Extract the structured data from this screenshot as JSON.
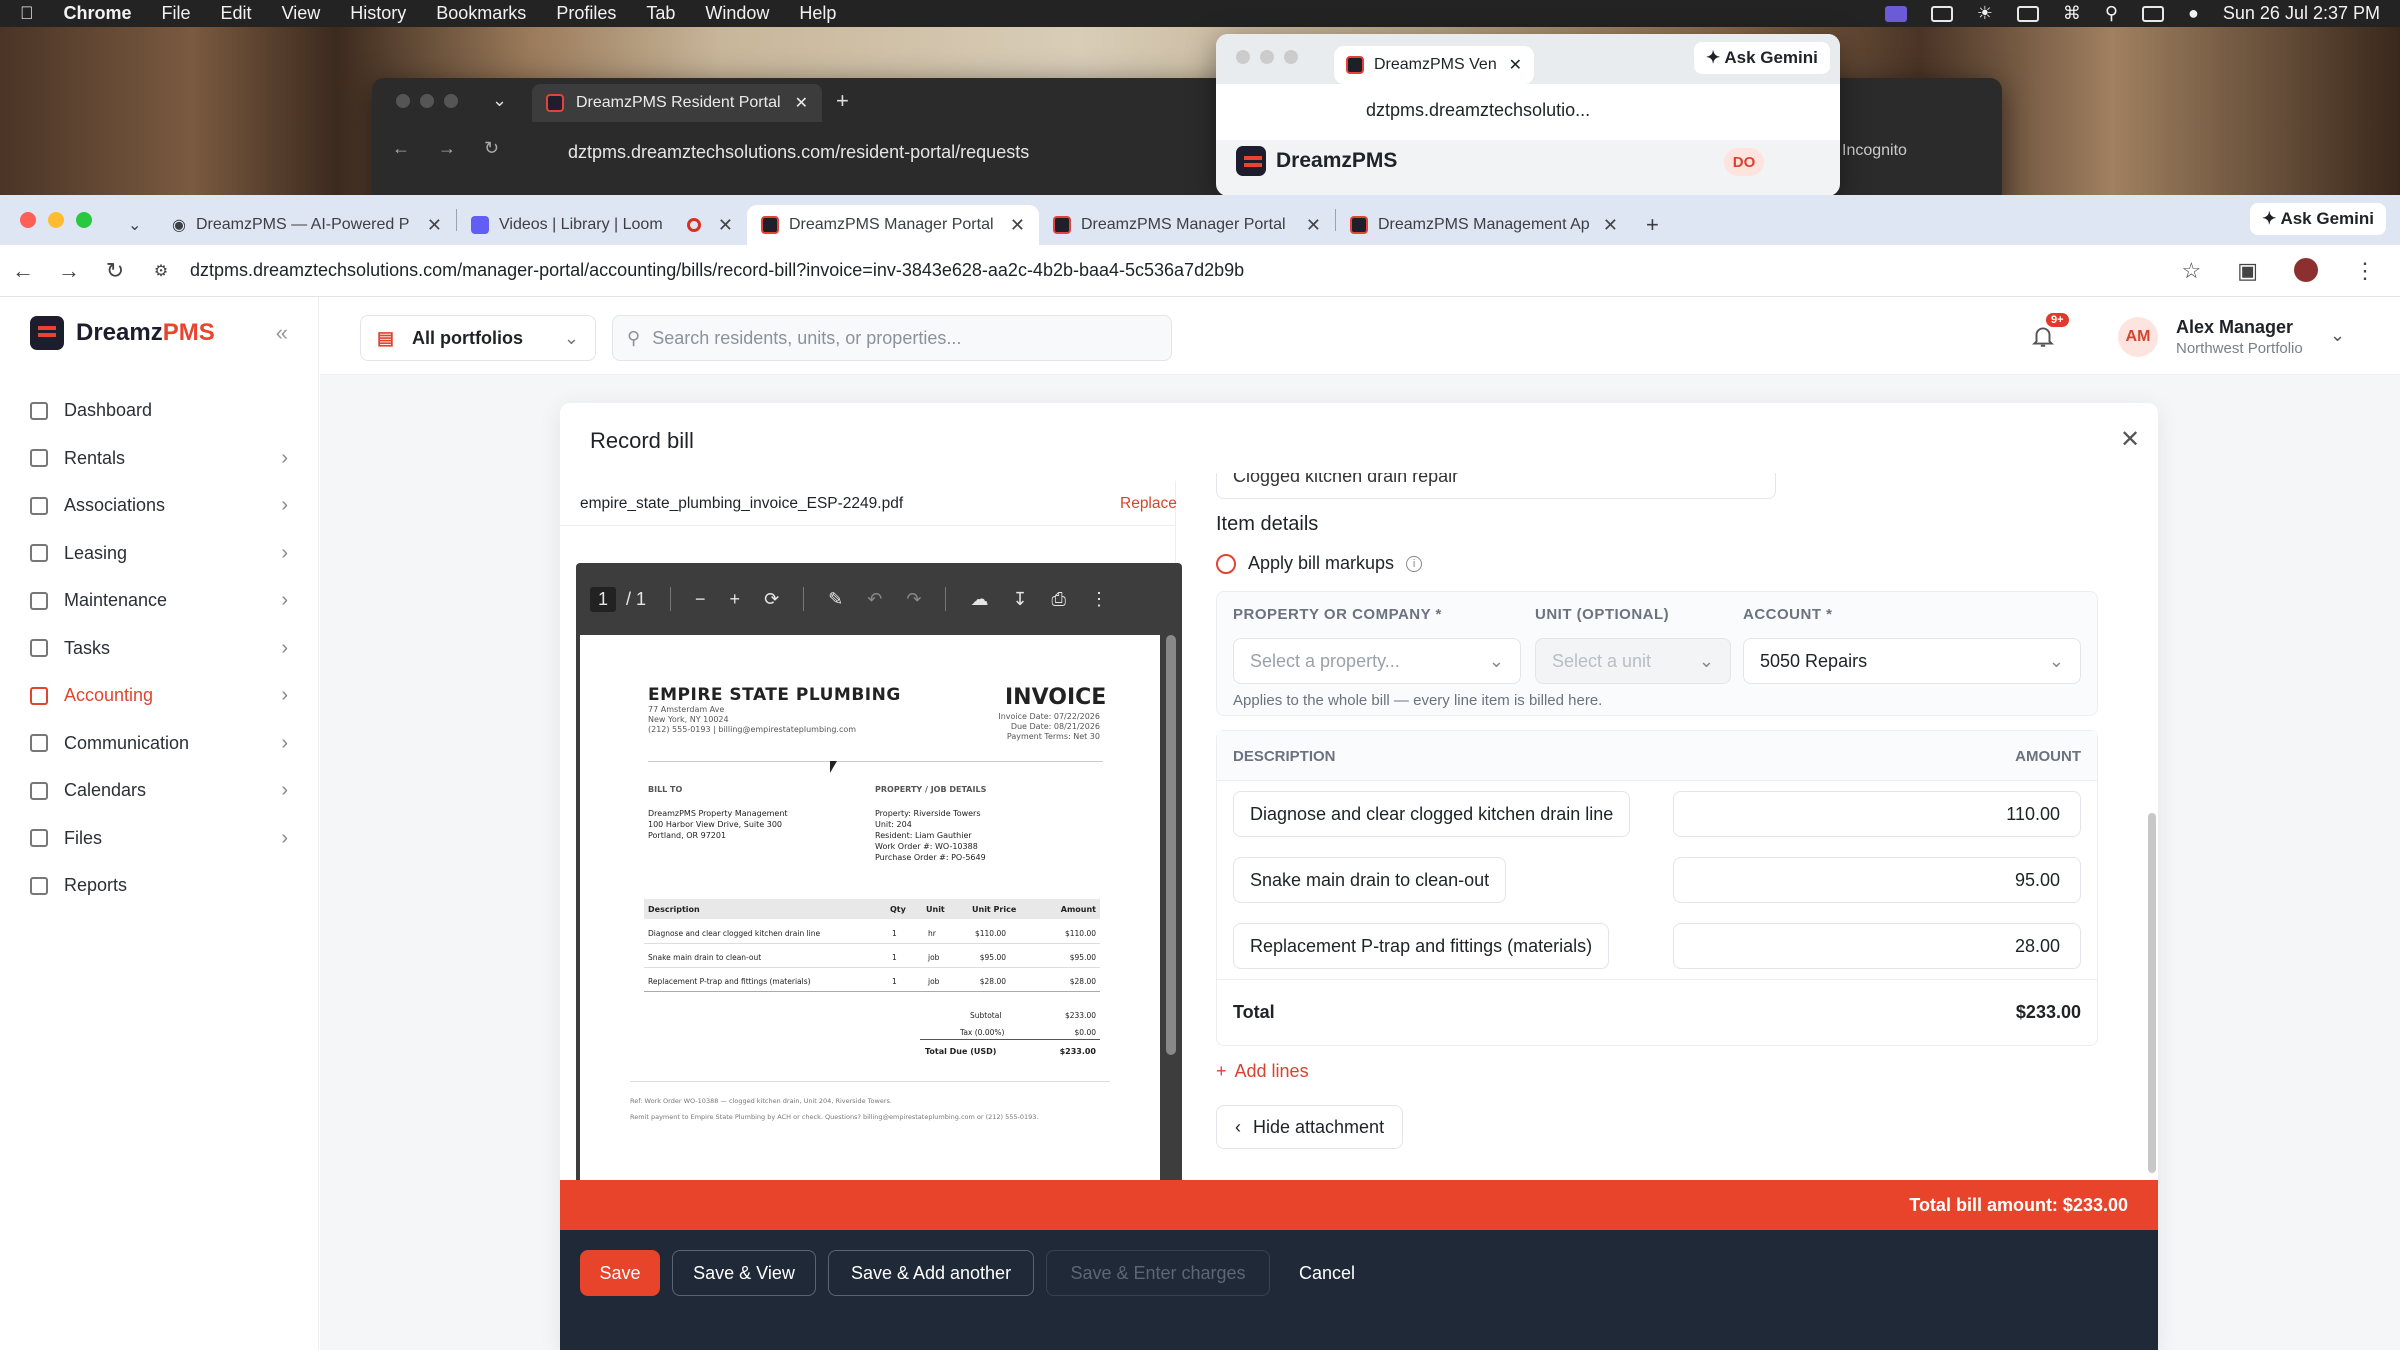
{
  "menubar": {
    "app": "Chrome",
    "items": [
      "File",
      "Edit",
      "View",
      "History",
      "Bookmarks",
      "Profiles",
      "Tab",
      "Window",
      "Help"
    ],
    "clock": "Sun 26 Jul  2:37 PM"
  },
  "bg_window_1": {
    "tab_title": "DreamzPMS Resident Portal",
    "url": "dztpms.dreamztechsolutions.com/resident-portal/requests"
  },
  "bg_window_2": {
    "tab_title": "DreamzPMS Ven",
    "ask_gemini": "Ask Gemini",
    "url": "dztpms.dreamztechsolutio...",
    "brand": "DreamzPMS",
    "avatar": "DO",
    "incognito": "Incognito"
  },
  "browser": {
    "tabs": [
      {
        "title": "DreamzPMS — AI-Powered P"
      },
      {
        "title": "Videos | Library | Loom"
      },
      {
        "title": "DreamzPMS Manager Portal"
      },
      {
        "title": "DreamzPMS Manager Portal"
      },
      {
        "title": "DreamzPMS Management Ap"
      }
    ],
    "ask_gemini": "Ask Gemini",
    "url": "dztpms.dreamztechsolutions.com/manager-portal/accounting/bills/record-bill?invoice=inv-3843e628-aa2c-4b2b-baa4-5c536a7d2b9b"
  },
  "sidebar": {
    "brand_prefix": "Dreamz",
    "brand_suffix": "PMS",
    "items": [
      {
        "label": "Dashboard"
      },
      {
        "label": "Rentals"
      },
      {
        "label": "Associations"
      },
      {
        "label": "Leasing"
      },
      {
        "label": "Maintenance"
      },
      {
        "label": "Tasks"
      },
      {
        "label": "Accounting"
      },
      {
        "label": "Communication"
      },
      {
        "label": "Calendars"
      },
      {
        "label": "Files"
      },
      {
        "label": "Reports"
      }
    ]
  },
  "topbar": {
    "portfolio": "All portfolios",
    "search_placeholder": "Search residents, units, or properties...",
    "badge": "9+",
    "avatar": "AM",
    "user_name": "Alex Manager",
    "user_sub": "Northwest Portfolio"
  },
  "modal": {
    "title": "Record bill",
    "file_name": "empire_state_plumbing_invoice_ESP-2249.pdf",
    "replace": "Replace",
    "pdf_page": "1",
    "pdf_total": "/  1",
    "memo_value": "Clogged kitchen drain repair",
    "item_details_title": "Item details",
    "apply_markups": "Apply bill markups",
    "property_label": "PROPERTY OR COMPANY *",
    "property_placeholder": "Select a property...",
    "unit_label": "UNIT (OPTIONAL)",
    "unit_placeholder": "Select a unit",
    "account_label": "ACCOUNT *",
    "account_value": "5050 Repairs",
    "hint": "Applies to the whole bill — every line item is billed here.",
    "col_description": "DESCRIPTION",
    "col_amount": "AMOUNT",
    "lines": [
      {
        "description": "Diagnose and clear clogged kitchen drain line",
        "amount": "110.00"
      },
      {
        "description": "Snake main drain to clean-out",
        "amount": "95.00"
      },
      {
        "description": "Replacement P-trap and fittings (materials)",
        "amount": "28.00"
      }
    ],
    "total_label": "Total",
    "total_value": "$233.00",
    "add_lines": "Add lines",
    "hide_attachment": "Hide attachment",
    "total_bill": "Total bill amount: $233.00",
    "buttons": {
      "save": "Save",
      "save_view": "Save & View",
      "save_add": "Save & Add another",
      "save_enter": "Save & Enter charges",
      "cancel": "Cancel"
    }
  },
  "invoice": {
    "company": "EMPIRE STATE PLUMBING",
    "address1": "77 Amsterdam Ave",
    "address2": "New York, NY 10024",
    "contact": "(212) 555-0193  |  billing@empirestateplumbing.com",
    "heading": "INVOICE",
    "invoice_date": "Invoice Date: 07/22/2026",
    "due_date": "Due Date: 08/21/2026",
    "terms": "Payment Terms: Net 30",
    "bill_to_label": "BILL TO",
    "bill_to_1": "DreamzPMS Property Management",
    "bill_to_2": "100 Harbor View Drive, Suite 300",
    "bill_to_3": "Portland, OR 97201",
    "job_label": "PROPERTY / JOB DETAILS",
    "job_1": "Property: Riverside Towers",
    "job_2": "Unit: 204",
    "job_3": "Resident: Liam Gauthier",
    "job_4": "Work Order #: WO-10388",
    "job_5": "Purchase Order #: PO-5649",
    "th_desc": "Description",
    "th_qty": "Qty",
    "th_unit": "Unit",
    "th_price": "Unit Price",
    "th_amount": "Amount",
    "rows": [
      {
        "desc": "Diagnose and clear clogged kitchen drain line",
        "qty": "1",
        "unit": "hr",
        "price": "$110.00",
        "amount": "$110.00"
      },
      {
        "desc": "Snake main drain to clean-out",
        "qty": "1",
        "unit": "job",
        "price": "$95.00",
        "amount": "$95.00"
      },
      {
        "desc": "Replacement P-trap and fittings (materials)",
        "qty": "1",
        "unit": "job",
        "price": "$28.00",
        "amount": "$28.00"
      }
    ],
    "subtotal_label": "Subtotal",
    "subtotal": "$233.00",
    "tax_label": "Tax (0.00%)",
    "tax": "$0.00",
    "due_label": "Total Due (USD)",
    "due": "$233.00",
    "note1": "Ref: Work Order WO-10388 — clogged kitchen drain, Unit 204, Riverside Towers.",
    "note2": "Remit payment to Empire State Plumbing by ACH or check. Questions? billing@empirestateplumbing.com or (212) 555-0193."
  },
  "colors": {
    "accent": "#e0452f",
    "footer": "#1f2937",
    "total_bar": "#e8432b"
  }
}
